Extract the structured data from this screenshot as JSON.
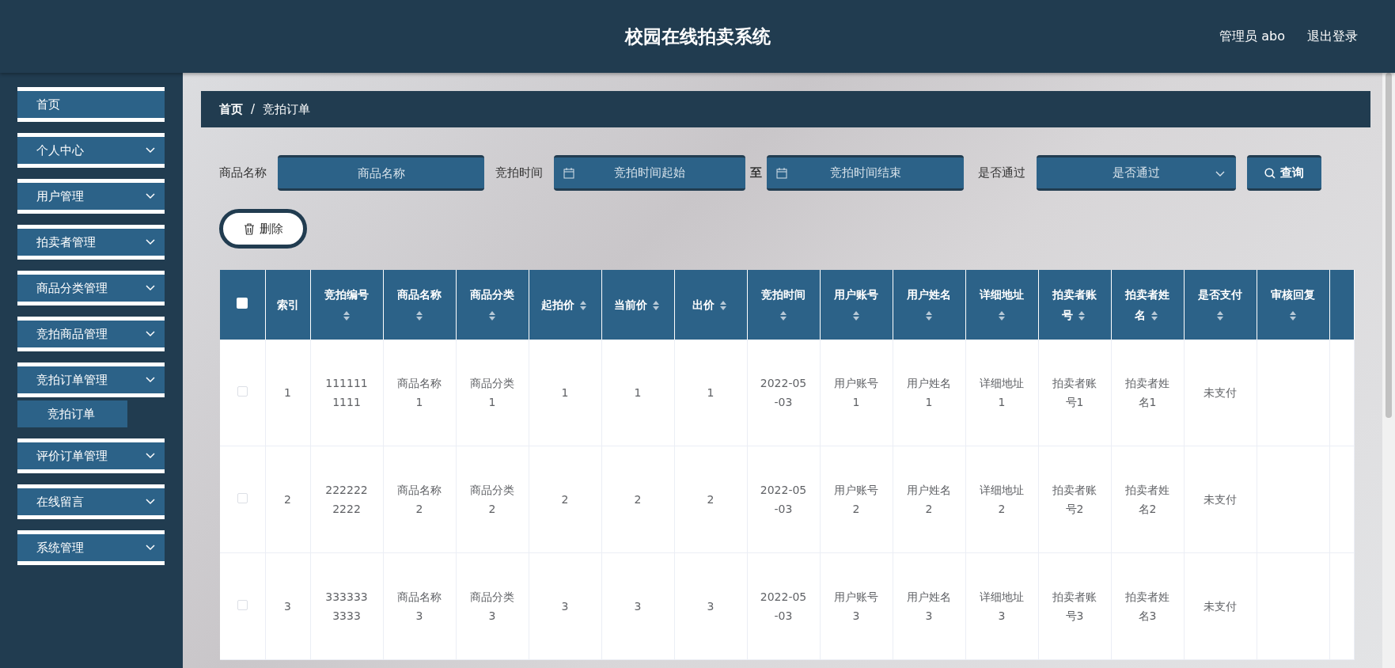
{
  "header": {
    "title": "校园在线拍卖系统",
    "user": "管理员 abo",
    "logout": "退出登录"
  },
  "sidebar": {
    "items": [
      {
        "label": "首页",
        "kind": "link"
      },
      {
        "label": "个人中心",
        "kind": "submenu"
      },
      {
        "label": "用户管理",
        "kind": "submenu"
      },
      {
        "label": "拍卖者管理",
        "kind": "submenu"
      },
      {
        "label": "商品分类管理",
        "kind": "submenu"
      },
      {
        "label": "竞拍商品管理",
        "kind": "submenu"
      },
      {
        "label": "竞拍订单管理",
        "kind": "submenu",
        "children": [
          {
            "label": "竞拍订单"
          }
        ]
      },
      {
        "label": "评价订单管理",
        "kind": "submenu"
      },
      {
        "label": "在线留言",
        "kind": "submenu"
      },
      {
        "label": "系统管理",
        "kind": "submenu"
      }
    ]
  },
  "breadcrumb": {
    "items": [
      "首页",
      "竞拍订单"
    ],
    "separator": "/"
  },
  "filters": {
    "name_label": "商品名称",
    "name_placeholder": "商品名称",
    "time_label": "竞拍时间",
    "start_placeholder": "竞拍时间起始",
    "range_separator": "至",
    "end_placeholder": "竞拍时间结束",
    "pass_label": "是否通过",
    "pass_placeholder": "是否通过",
    "search_button": "查询"
  },
  "delete_button": "删除",
  "table": {
    "select_all_checked": false,
    "columns": [
      {
        "label": "索引",
        "sortable": false
      },
      {
        "label": "竞拍编号",
        "sortable": true
      },
      {
        "label": "商品名称",
        "sortable": true
      },
      {
        "label": "商品分类",
        "sortable": true
      },
      {
        "label": "起拍价",
        "sortable": true
      },
      {
        "label": "当前价",
        "sortable": true
      },
      {
        "label": "出价",
        "sortable": true
      },
      {
        "label": "竞拍时间",
        "sortable": true
      },
      {
        "label": "用户账号",
        "sortable": true
      },
      {
        "label": "用户姓名",
        "sortable": true
      },
      {
        "label": "详细地址",
        "sortable": true
      },
      {
        "label": "拍卖者账号",
        "sortable": true
      },
      {
        "label": "拍卖者姓名",
        "sortable": true
      },
      {
        "label": "是否支付",
        "sortable": true
      },
      {
        "label": "审核回复",
        "sortable": true
      }
    ],
    "rows": [
      {
        "checked": false,
        "cells": [
          "1",
          "1111111111",
          "商品名称1",
          "商品分类1",
          "1",
          "1",
          "1",
          "2022-05-03",
          "用户账号1",
          "用户姓名1",
          "详细地址1",
          "拍卖者账号1",
          "拍卖者姓名1",
          "未支付",
          ""
        ]
      },
      {
        "checked": false,
        "cells": [
          "2",
          "2222222222",
          "商品名称2",
          "商品分类2",
          "2",
          "2",
          "2",
          "2022-05-03",
          "用户账号2",
          "用户姓名2",
          "详细地址2",
          "拍卖者账号2",
          "拍卖者姓名2",
          "未支付",
          ""
        ]
      },
      {
        "checked": false,
        "cells": [
          "3",
          "3333333333",
          "商品名称3",
          "商品分类3",
          "3",
          "3",
          "3",
          "2022-05-03",
          "用户账号3",
          "用户姓名3",
          "详细地址3",
          "拍卖者账号3",
          "拍卖者姓名3",
          "未支付",
          ""
        ]
      }
    ]
  }
}
